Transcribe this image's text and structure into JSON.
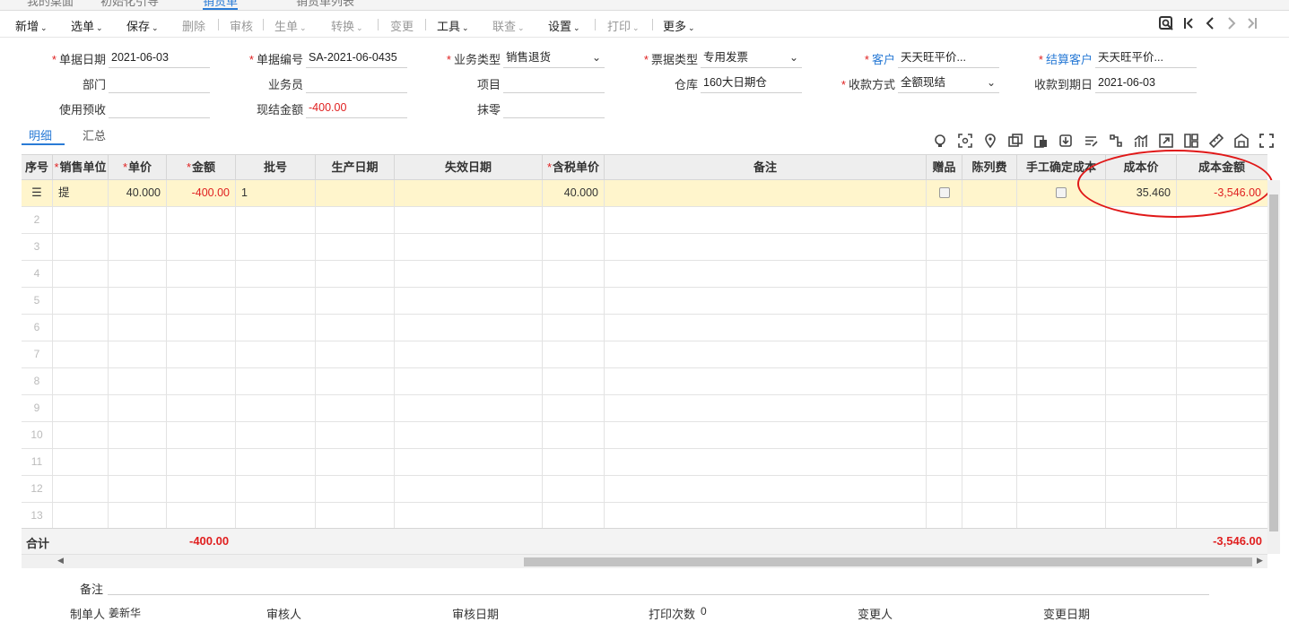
{
  "tabstrip": [
    "我的桌面",
    "初始化引导",
    "销货单",
    "销货单列表"
  ],
  "toolbar": {
    "items": [
      {
        "label": "新增",
        "dropdown": true,
        "enabled": true
      },
      {
        "label": "选单",
        "dropdown": true,
        "enabled": true
      },
      {
        "label": "保存",
        "dropdown": true,
        "enabled": true
      },
      {
        "label": "删除",
        "dropdown": false,
        "enabled": false
      },
      {
        "label": "审核",
        "dropdown": false,
        "enabled": false
      },
      {
        "label": "生单",
        "dropdown": true,
        "enabled": false
      },
      {
        "label": "转换",
        "dropdown": true,
        "enabled": false
      },
      {
        "label": "变更",
        "dropdown": false,
        "enabled": false
      },
      {
        "label": "工具",
        "dropdown": true,
        "enabled": true
      },
      {
        "label": "联查",
        "dropdown": true,
        "enabled": false
      },
      {
        "label": "设置",
        "dropdown": true,
        "enabled": true
      },
      {
        "label": "打印",
        "dropdown": true,
        "enabled": false
      },
      {
        "label": "更多",
        "dropdown": true,
        "enabled": true
      }
    ],
    "caret": "⌄",
    "nav": [
      "search-doc-icon",
      "first-page-icon",
      "prev-icon",
      "next-icon",
      "last-page-icon"
    ]
  },
  "form": {
    "doc_date_label": "单据日期",
    "doc_date": "2021-06-03",
    "doc_no_label": "单据编号",
    "doc_no": "SA-2021-06-0435",
    "biz_type_label": "业务类型",
    "biz_type": "销售退货",
    "invoice_type_label": "票据类型",
    "invoice_type": "专用发票",
    "customer_label": "客户",
    "customer": "天天旺平价...",
    "settle_customer_label": "结算客户",
    "settle_customer": "天天旺平价...",
    "dept_label": "部门",
    "dept": "",
    "salesman_label": "业务员",
    "salesman": "",
    "project_label": "项目",
    "project": "",
    "warehouse_label": "仓库",
    "warehouse": "160大日期仓",
    "pay_method_label": "收款方式",
    "pay_method": "全额现结",
    "due_date_label": "收款到期日",
    "due_date": "2021-06-03",
    "prepay_label": "使用预收",
    "prepay": "",
    "cash_amount_label": "现结金额",
    "cash_amount": "-400.00",
    "rounding_label": "抹零",
    "rounding": ""
  },
  "subtabs": {
    "detail": "明细",
    "summary": "汇总"
  },
  "grid": {
    "columns": {
      "seq": "序号",
      "unit": "销售单位",
      "price": "单价",
      "amount": "金额",
      "batch": "批号",
      "prod_date": "生产日期",
      "exp_date": "失效日期",
      "tax_price": "含税单价",
      "remark": "备注",
      "gift": "赠品",
      "display_fee": "陈列费",
      "manual_cost": "手工确定成本",
      "cost_price": "成本价",
      "cost_amount": "成本金额"
    },
    "row1": {
      "unit": "提",
      "price": "40.000",
      "amount": "-400.00",
      "batch": "1",
      "tax_price": "40.000",
      "cost_price": "35.460",
      "cost_amount": "-3,546.00"
    },
    "row_numbers": [
      "2",
      "3",
      "4",
      "5",
      "6",
      "7",
      "8",
      "9",
      "10",
      "11",
      "12",
      "13"
    ],
    "total_label": "合计",
    "total_amount": "-400.00",
    "total_cost": "-3,546.00"
  },
  "footer": {
    "remark_label": "备注",
    "creator_label": "制单人",
    "creator": "姜新华",
    "auditor_label": "审核人",
    "audit_date_label": "审核日期",
    "print_count_label": "打印次数",
    "print_count": "0",
    "modifier_label": "变更人",
    "modify_date_label": "变更日期"
  }
}
